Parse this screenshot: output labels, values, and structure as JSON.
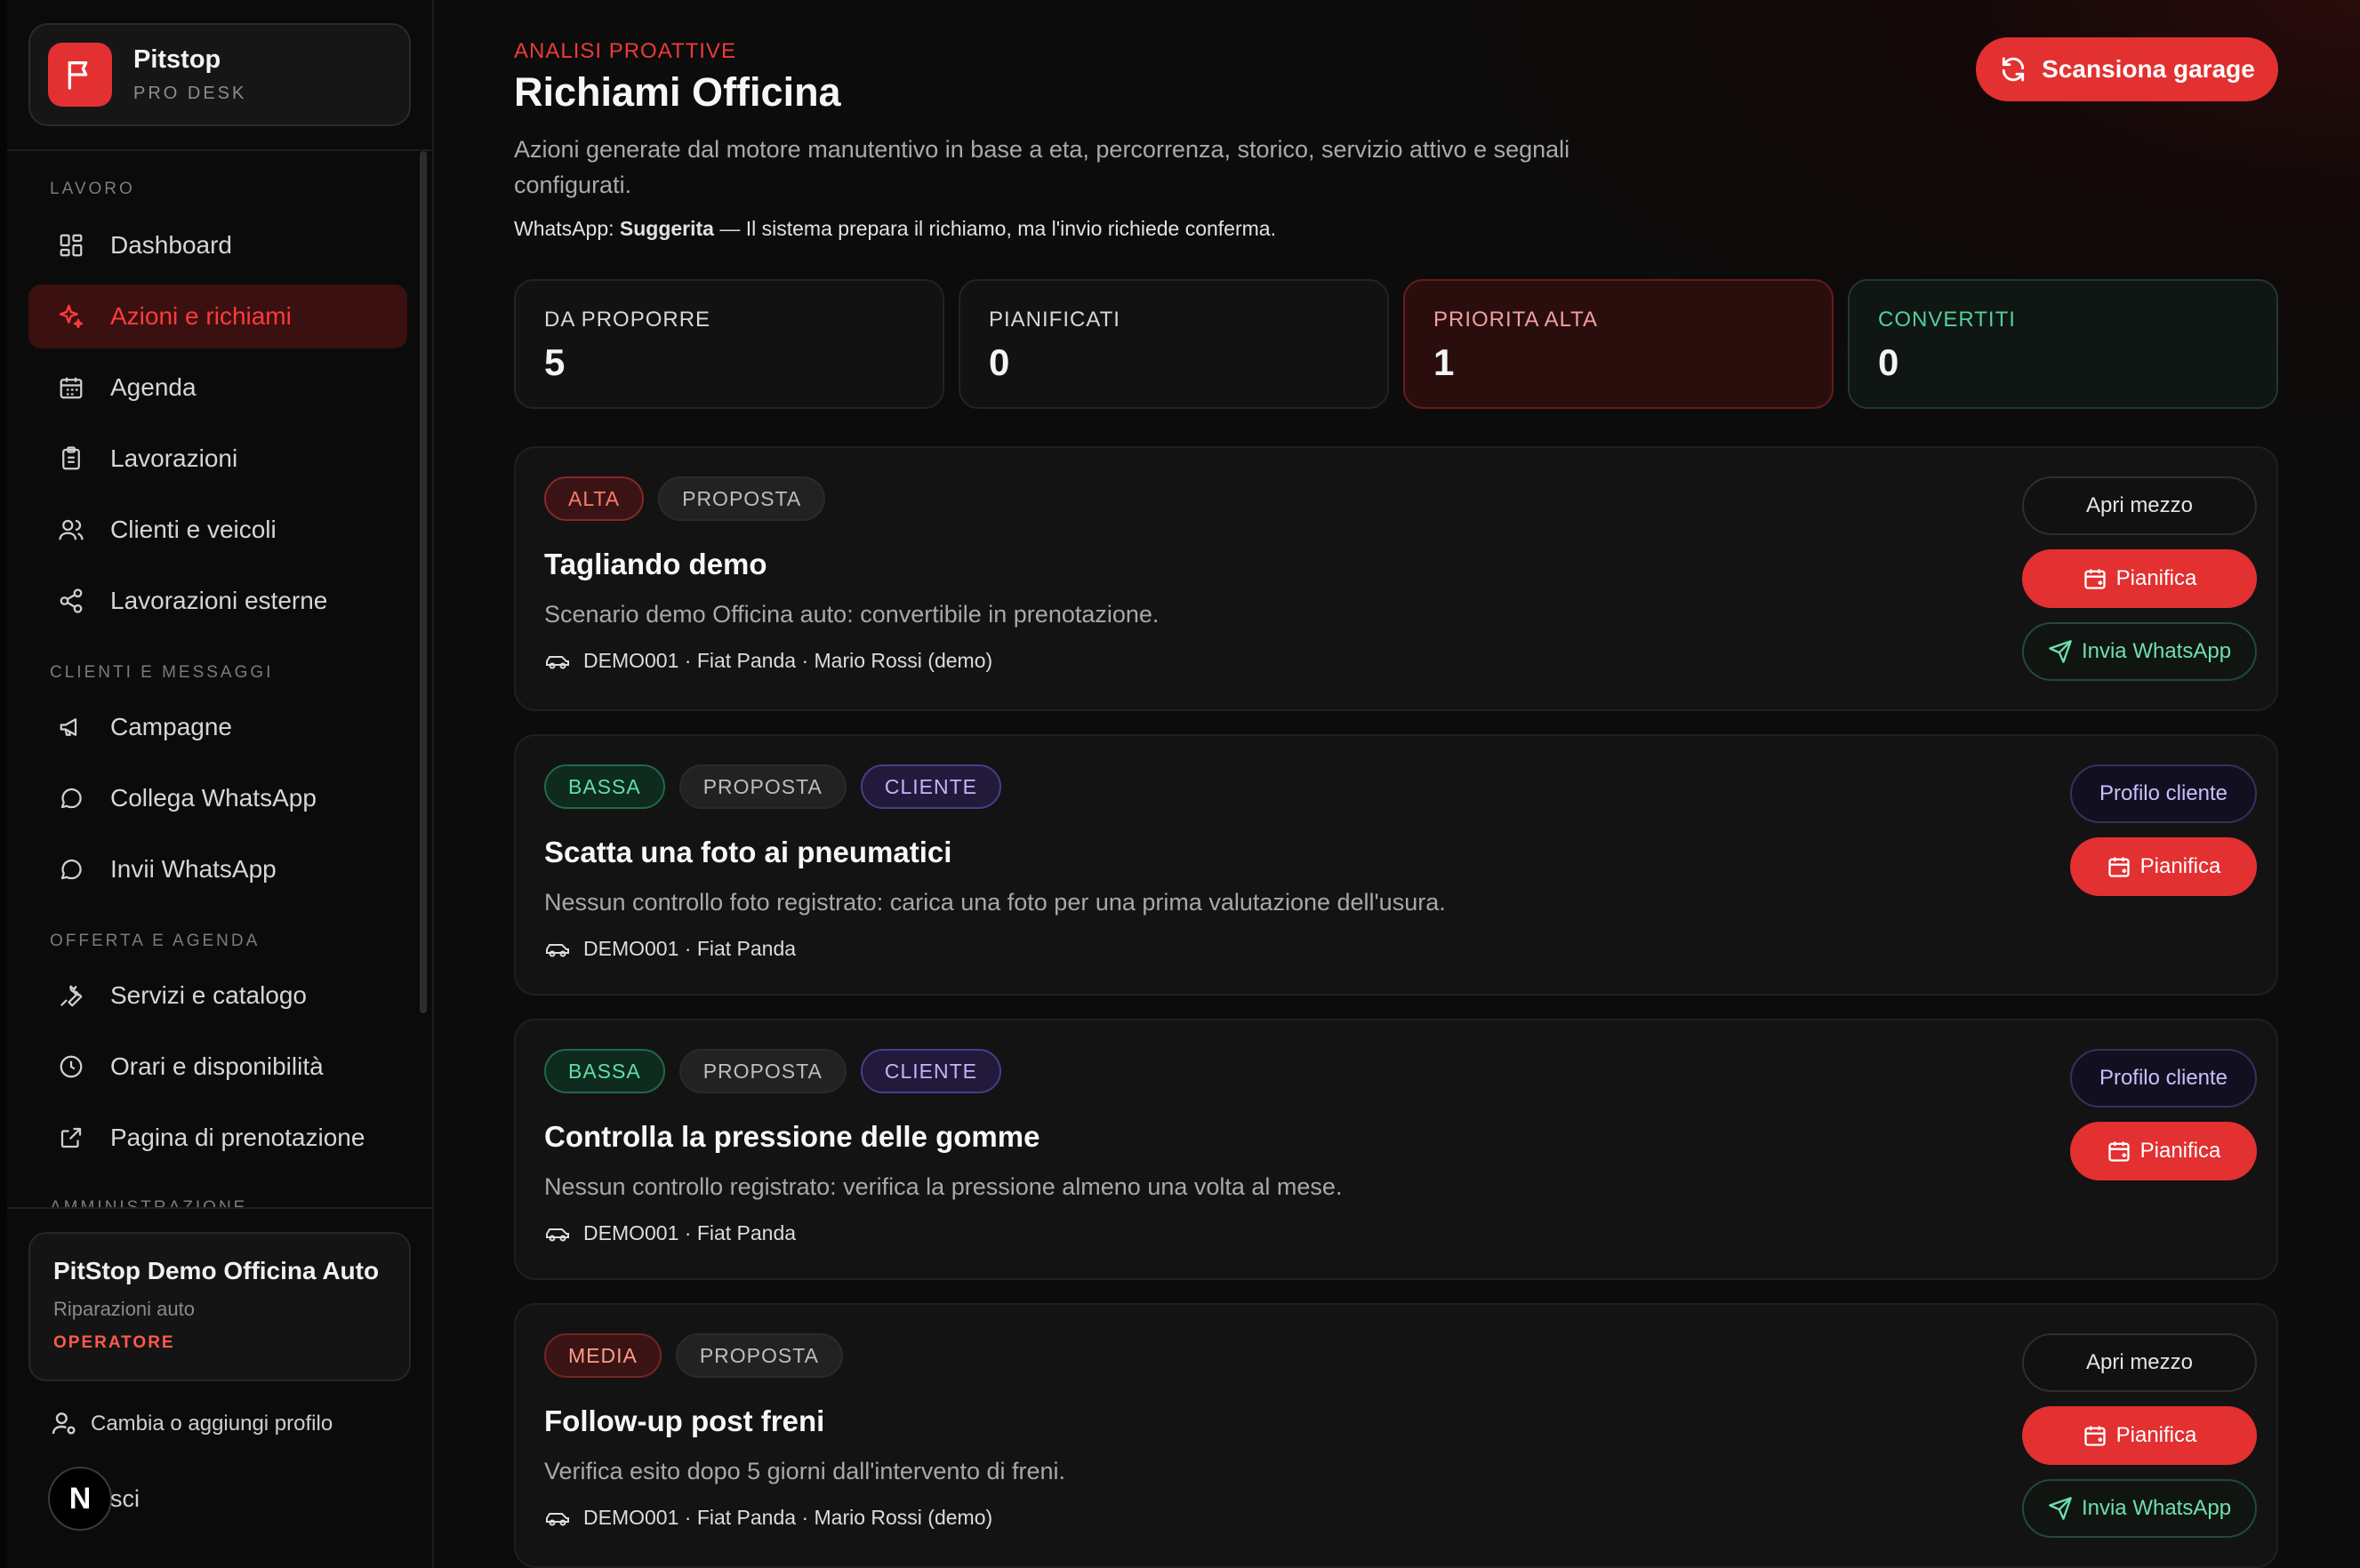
{
  "brand": {
    "name": "Pitstop",
    "subtitle": "PRO DESK"
  },
  "nav": {
    "sections": [
      {
        "label": "LAVORO"
      },
      {
        "label": "CLIENTI E MESSAGGI"
      },
      {
        "label": "OFFERTA E AGENDA"
      },
      {
        "label": "AMMINISTRAZIONE"
      }
    ],
    "items": [
      {
        "label": "Dashboard",
        "icon": "dashboard-icon"
      },
      {
        "label": "Azioni e richiami",
        "icon": "sparkle-icon",
        "active": true
      },
      {
        "label": "Agenda",
        "icon": "calendar-icon"
      },
      {
        "label": "Lavorazioni",
        "icon": "clipboard-icon"
      },
      {
        "label": "Clienti e veicoli",
        "icon": "users-icon"
      },
      {
        "label": "Lavorazioni esterne",
        "icon": "share-icon"
      },
      {
        "label": "Campagne",
        "icon": "megaphone-icon"
      },
      {
        "label": "Collega WhatsApp",
        "icon": "chat-icon"
      },
      {
        "label": "Invii WhatsApp",
        "icon": "chat-icon"
      },
      {
        "label": "Servizi e catalogo",
        "icon": "wrench-icon"
      },
      {
        "label": "Orari e disponibilità",
        "icon": "clock-icon"
      },
      {
        "label": "Pagina di prenotazione",
        "icon": "external-link-icon"
      }
    ]
  },
  "org": {
    "name": "PitStop Demo Officina Auto",
    "type": "Riparazioni auto",
    "role": "OPERATORE"
  },
  "profile": {
    "switch_label": "Cambia o aggiungi profilo",
    "badge": "N",
    "logout_label": "sci"
  },
  "header": {
    "eyebrow": "ANALISI PROATTIVE",
    "title": "Richiami Officina",
    "description": "Azioni generate dal motore manutentivo in base a eta, percorrenza, storico, servizio attivo e segnali configurati.",
    "whatsapp_prefix": "WhatsApp:",
    "whatsapp_mode": "Suggerita",
    "whatsapp_suffix": "— Il sistema prepara il richiamo, ma l'invio richiede conferma.",
    "scan_label": "Scansiona garage"
  },
  "stats": [
    {
      "label": "DA PROPORRE",
      "value": "5"
    },
    {
      "label": "PIANIFICATI",
      "value": "0"
    },
    {
      "label": "PRIORITA ALTA",
      "value": "1"
    },
    {
      "label": "CONVERTITI",
      "value": "0"
    }
  ],
  "cards": [
    {
      "chips": [
        "ALTA",
        "PROPOSTA"
      ],
      "title": "Tagliando demo",
      "description": "Scenario demo Officina auto: convertibile in prenotazione.",
      "meta": "DEMO001 · Fiat Panda · Mario Rossi (demo)",
      "actions": [
        "Apri mezzo",
        "Pianifica",
        "Invia WhatsApp"
      ]
    },
    {
      "chips": [
        "BASSA",
        "PROPOSTA",
        "CLIENTE"
      ],
      "title": "Scatta una foto ai pneumatici",
      "description": "Nessun controllo foto registrato: carica una foto per una prima valutazione dell'usura.",
      "meta": "DEMO001 · Fiat Panda",
      "actions": [
        "Profilo cliente",
        "Pianifica"
      ]
    },
    {
      "chips": [
        "BASSA",
        "PROPOSTA",
        "CLIENTE"
      ],
      "title": "Controlla la pressione delle gomme",
      "description": "Nessun controllo registrato: verifica la pressione almeno una volta al mese.",
      "meta": "DEMO001 · Fiat Panda",
      "actions": [
        "Profilo cliente",
        "Pianifica"
      ]
    },
    {
      "chips": [
        "MEDIA",
        "PROPOSTA"
      ],
      "title": "Follow-up post freni",
      "description": "Verifica esito dopo 5 giorni dall'intervento di freni.",
      "meta": "DEMO001 · Fiat Panda · Mario Rossi (demo)",
      "actions": [
        "Apri mezzo",
        "Pianifica",
        "Invia WhatsApp"
      ]
    }
  ],
  "colors": {
    "accent": "#e33030",
    "success": "#5ee0a6",
    "client": "#c4b3ff"
  }
}
